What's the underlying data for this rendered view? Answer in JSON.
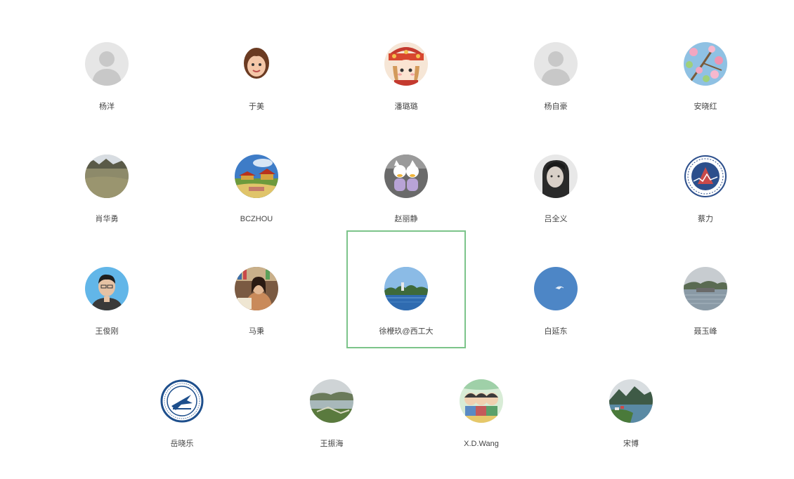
{
  "contacts": [
    {
      "name": "杨洋",
      "avatar": "default-avatar-icon"
    },
    {
      "name": "于美",
      "avatar": "cartoon-girl-avatar"
    },
    {
      "name": "潘璐璐",
      "avatar": "cartoon-headdress-avatar"
    },
    {
      "name": "杨自豪",
      "avatar": "default-avatar-icon"
    },
    {
      "name": "安晓红",
      "avatar": "flower-branch-avatar"
    },
    {
      "name": "肖华勇",
      "avatar": "grass-field-avatar"
    },
    {
      "name": "BCZHOU",
      "avatar": "temple-landscape-avatar"
    },
    {
      "name": "赵丽静",
      "avatar": "plush-toys-avatar"
    },
    {
      "name": "吕全义",
      "avatar": "woman-portrait-avatar"
    },
    {
      "name": "蔡力",
      "avatar": "round-emblem-avatar"
    },
    {
      "name": "王俊刚",
      "avatar": "man-portrait-avatar"
    },
    {
      "name": "马秉",
      "avatar": "woman-reading-avatar"
    },
    {
      "name": "徐楩玖@西工大",
      "avatar": "lake-scene-avatar",
      "selected": true
    },
    {
      "name": "白延东",
      "avatar": "blue-sky-avatar"
    },
    {
      "name": "聂玉峰",
      "avatar": "river-scene-avatar"
    },
    {
      "name": "岳晓乐",
      "avatar": "university-seal-avatar"
    },
    {
      "name": "王振海",
      "avatar": "garden-lake-avatar"
    },
    {
      "name": "X.D.Wang",
      "avatar": "cartoon-kids-avatar"
    },
    {
      "name": "宋博",
      "avatar": "mountain-lake-avatar"
    }
  ],
  "colors": {
    "selection_border": "#7cc48a",
    "name_text": "#444444",
    "background": "#ffffff"
  }
}
